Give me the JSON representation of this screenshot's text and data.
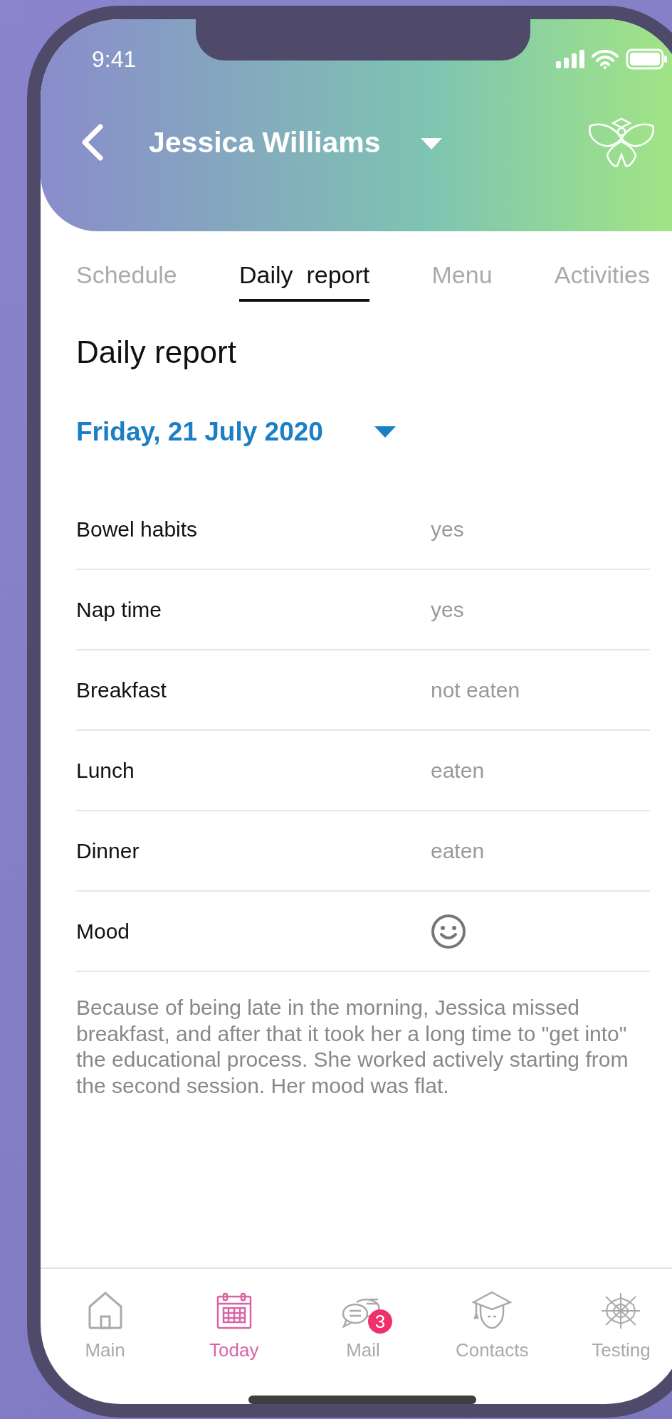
{
  "status_bar": {
    "time": "9:41"
  },
  "header": {
    "title": "Jessica Williams"
  },
  "tabs": [
    {
      "label": "Schedule",
      "selected": false
    },
    {
      "label": "Daily  report",
      "selected": true
    },
    {
      "label": "Menu",
      "selected": false
    },
    {
      "label": "Activities",
      "selected": false
    }
  ],
  "heading": "Daily report",
  "date": "Friday, 21 July 2020",
  "rows": [
    {
      "label": "Bowel habits",
      "kind": "text",
      "value": "yes"
    },
    {
      "label": "Nap time",
      "kind": "text",
      "value": "yes"
    },
    {
      "label": "Breakfast",
      "kind": "text",
      "value": "not eaten"
    },
    {
      "label": "Lunch",
      "kind": "text",
      "value": "eaten"
    },
    {
      "label": "Dinner",
      "kind": "text",
      "value": "eaten"
    },
    {
      "label": "Mood",
      "kind": "mood"
    }
  ],
  "note": "Because of being late in the morning, Jessica missed breakfast, and after that it took her a long time to \"get into\" the educational process. She worked actively starting from the second session. Her mood was flat.",
  "nav": [
    {
      "label": "Main",
      "kind": "home",
      "selected": false
    },
    {
      "label": "Today",
      "kind": "calendar",
      "selected": true
    },
    {
      "label": "Mail",
      "kind": "chat",
      "selected": false,
      "badge": "3"
    },
    {
      "label": "Contacts",
      "kind": "student",
      "selected": false
    },
    {
      "label": "Testing",
      "kind": "web",
      "selected": false
    }
  ]
}
